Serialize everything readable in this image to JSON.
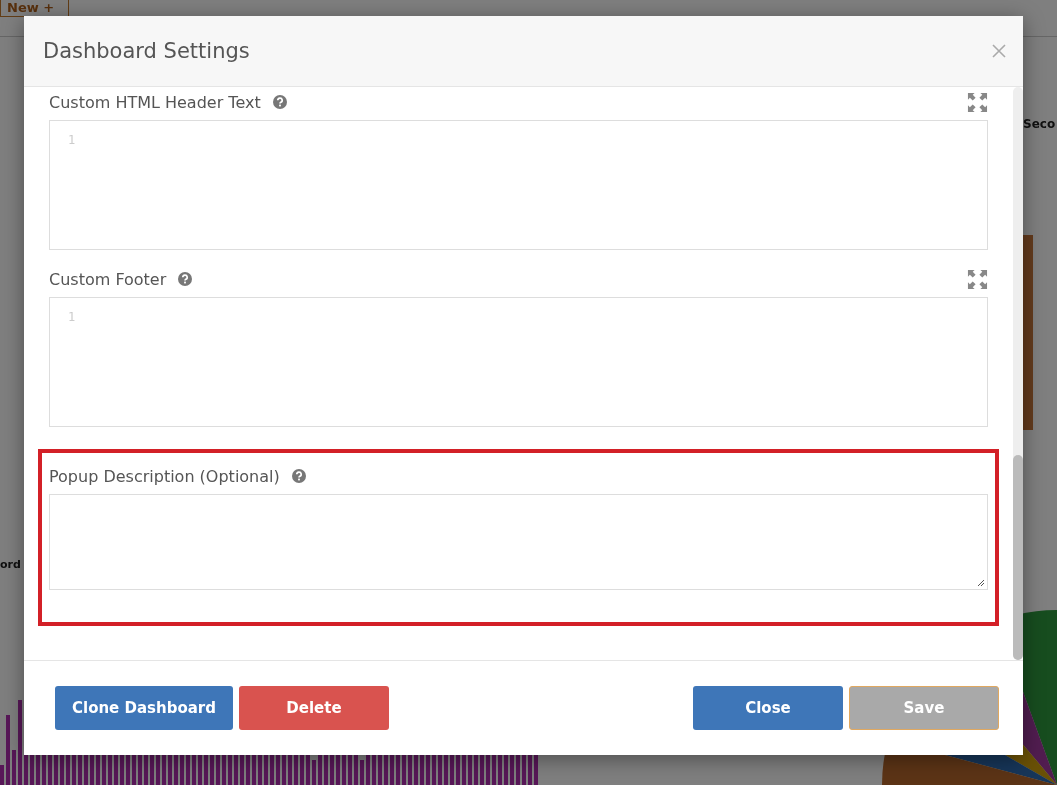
{
  "background": {
    "tab": "New +",
    "left_label": "ord",
    "right_label": "Seco"
  },
  "dialog": {
    "title": "Dashboard Settings",
    "fields": [
      {
        "kind": "code",
        "label": "Custom HTML Header Text",
        "line_number": "1",
        "highlighted": false
      },
      {
        "kind": "code",
        "label": "Custom Footer",
        "line_number": "1",
        "highlighted": false
      },
      {
        "kind": "textarea",
        "label": "Popup Description (Optional)",
        "highlighted": true
      }
    ],
    "left_buttons": [
      {
        "label": "Clone Dashboard",
        "kind": "primary",
        "disabled": false
      },
      {
        "label": "Delete",
        "kind": "danger",
        "disabled": false
      }
    ],
    "right_buttons": [
      {
        "label": "Close",
        "kind": "primary",
        "disabled": false
      },
      {
        "label": "Save",
        "kind": "default",
        "disabled": true
      }
    ]
  }
}
